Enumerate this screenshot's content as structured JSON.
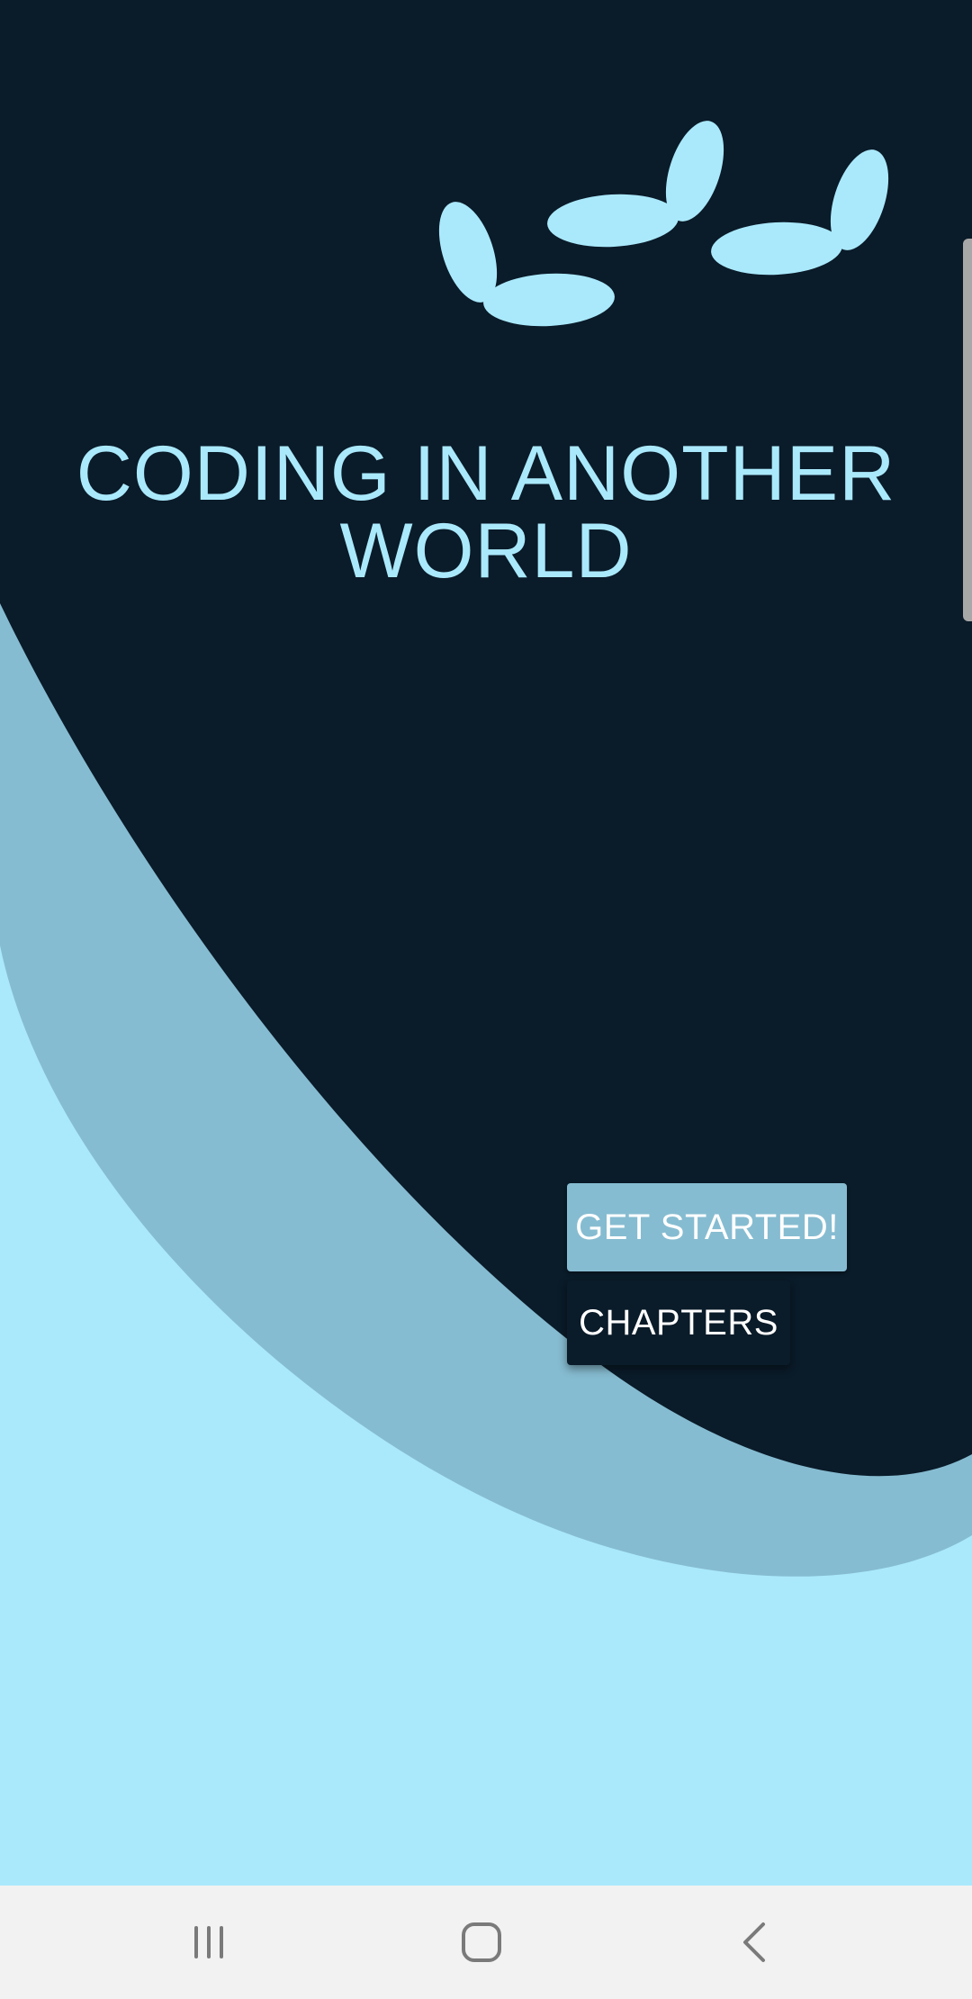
{
  "app": {
    "title": "CODING IN ANOTHER WORLD"
  },
  "buttons": {
    "get_started": "GET STARTED!",
    "chapters": "CHAPTERS"
  },
  "colors": {
    "background_dark": "#0a1b29",
    "wave_mid": "#86bcd1",
    "wave_light": "#aae9fc",
    "title_text": "#aae9fc",
    "button_primary_bg": "#86bcd1",
    "button_secondary_bg": "#0a1b29",
    "button_text": "#ffffff",
    "navbar_bg": "#f2f2f2",
    "navbar_icon": "#7a7a7a"
  },
  "icons": {
    "decoration": "butterflies-illustration",
    "nav_recent": "recent-apps-icon",
    "nav_home": "home-icon",
    "nav_back": "back-icon"
  }
}
